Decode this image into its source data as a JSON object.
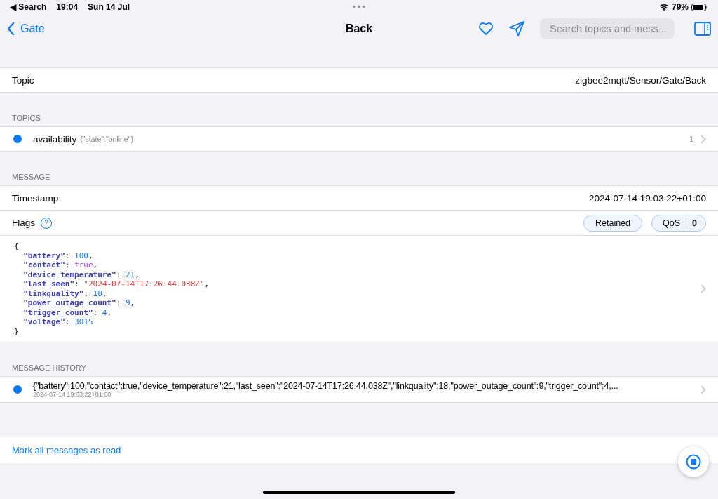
{
  "status_bar": {
    "back_app": "◀ Search",
    "time": "19:04",
    "date": "Sun 14 Jul",
    "battery": "79%"
  },
  "nav": {
    "back": "Gate",
    "title": "Back",
    "search": {
      "placeholder": "Search topics and mess..."
    }
  },
  "topic": {
    "label": "Topic",
    "value": "zigbee2mqtt/Sensor/Gate/Back"
  },
  "topics": {
    "header": "TOPICS",
    "items": [
      {
        "name": "availability",
        "payload": "{\"state\":\"online\"}",
        "count": "1",
        "unread": true
      }
    ]
  },
  "message": {
    "header": "MESSAGE",
    "timestamp_label": "Timestamp",
    "timestamp": "2024-07-14 19:03:22+01:00",
    "flags_label": "Flags",
    "help": "?",
    "retained": "Retained",
    "qos_label": "QoS",
    "qos": "0",
    "json": {
      "open": "{",
      "close": "}",
      "lines": [
        {
          "key": "\"battery\"",
          "sep": ":",
          "value": "100",
          "kind": "number",
          "end": ","
        },
        {
          "key": "\"contact\"",
          "sep": ":",
          "value": "true",
          "kind": "bool",
          "end": ","
        },
        {
          "key": "\"device_temperature\"",
          "sep": ":",
          "value": "21",
          "kind": "number",
          "end": ","
        },
        {
          "key": "\"last_seen\"",
          "sep": ":",
          "value": "\"2024-07-14T17:26:44.038Z\"",
          "kind": "string",
          "end": ","
        },
        {
          "key": "\"linkquality\"",
          "sep": ":",
          "value": "18",
          "kind": "number",
          "end": ","
        },
        {
          "key": "\"power_outage_count\"",
          "sep": ":",
          "value": "9",
          "kind": "number",
          "end": ","
        },
        {
          "key": "\"trigger_count\"",
          "sep": ":",
          "value": "4",
          "kind": "number",
          "end": ","
        },
        {
          "key": "\"voltage\"",
          "sep": ":",
          "value": "3015",
          "kind": "number"
        }
      ]
    }
  },
  "history": {
    "header": "MESSAGE HISTORY",
    "items": [
      {
        "payload": "{\"battery\":100,\"contact\":true,\"device_temperature\":21,\"last_seen\":\"2024-07-14T17:26:44.038Z\",\"linkquality\":18,\"power_outage_count\":9,\"trigger_count\":4,...",
        "time": "2024-07-14 19:03:22+01:00",
        "unread": true
      }
    ]
  },
  "mark_all": "Mark all messages as read"
}
